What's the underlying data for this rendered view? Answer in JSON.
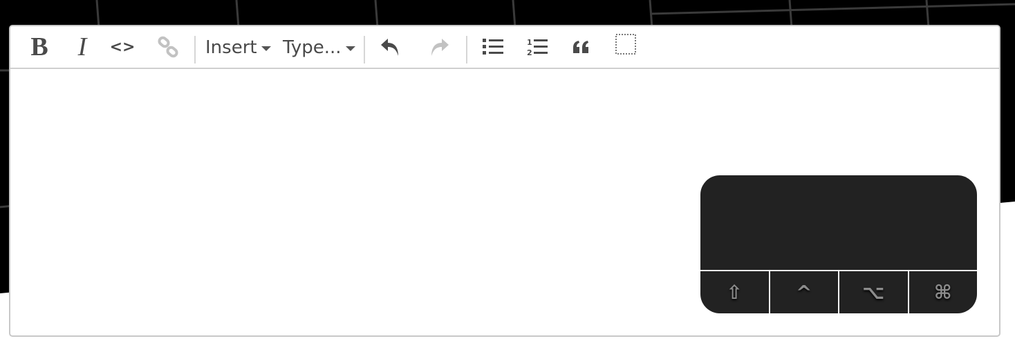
{
  "toolbar": {
    "bold_label": "B",
    "italic_label": "I",
    "code_label": "<>",
    "insert_label": "Insert",
    "type_label": "Type...",
    "icons": {
      "link": "link-icon",
      "undo": "undo-icon",
      "redo": "redo-icon",
      "bullet_list": "bullet-list-icon",
      "ordered_list": "ordered-list-icon",
      "blockquote": "blockquote-icon",
      "select_block": "select-block-icon"
    }
  },
  "modifier_pad": {
    "keys": [
      {
        "label": "⇧",
        "icon": "shift-key-icon"
      },
      {
        "label": "^",
        "icon": "control-key-icon"
      },
      {
        "label": "⌥",
        "icon": "option-key-icon"
      },
      {
        "label": "⌘",
        "icon": "command-key-icon"
      }
    ]
  },
  "colors": {
    "toolbar_icon": "#4a4a4a",
    "toolbar_icon_disabled": "#c2c2c2",
    "modifier_pad_bg": "#222222",
    "modifier_key_text": "#8c8c8c",
    "backdrop": "#000000"
  }
}
